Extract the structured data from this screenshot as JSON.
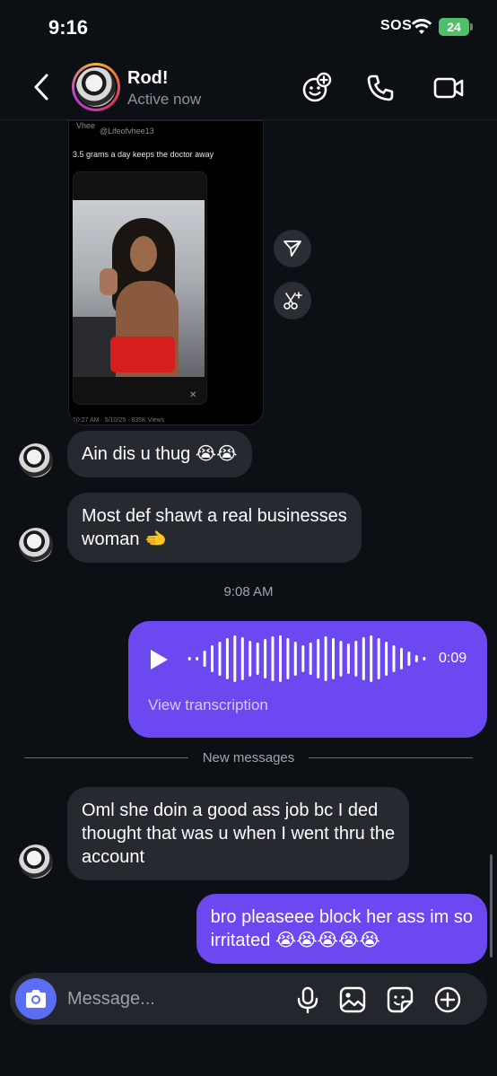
{
  "status_bar": {
    "time": "9:16",
    "sos": "SOS",
    "battery": "24"
  },
  "header": {
    "name": "Rod!",
    "status": "Active now"
  },
  "shared_post": {
    "author": "Vhee",
    "handle": "@Lifeofvhee13",
    "caption": "3.5 grams a day keeps the doctor away",
    "footer": "10:27 AM · 5/10/25 · 835K Views"
  },
  "messages": {
    "m1": "Ain dis u thug 😭😭",
    "m2_line1": "Most def shawt a real businesses",
    "m2_line2": "woman 🫲",
    "timestamp": "9:08 AM",
    "voice": {
      "duration": "0:09",
      "transcription": "View transcription"
    },
    "new_messages": "New messages",
    "m3_line1": "Oml she doin a good ass job bc I ded",
    "m3_line2": "thought that was u when I went thru the",
    "m3_line3": "account",
    "m4_line1": "bro pleaseee block her ass im so",
    "m4_line2": "irritated 😭😭😭😭😭"
  },
  "composer": {
    "placeholder": "Message..."
  },
  "colors": {
    "accent": "#6c48f1",
    "incoming_bubble": "#262a30",
    "background": "#0c0f14",
    "camera": "#5b6df2"
  }
}
